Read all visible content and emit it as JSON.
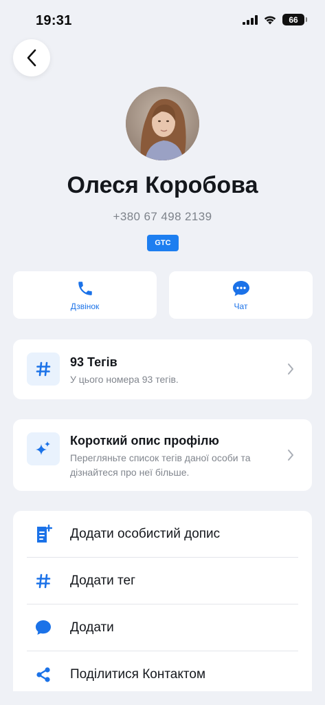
{
  "status_bar": {
    "time": "19:31",
    "battery": "66"
  },
  "profile": {
    "name": "Олеся Коробова",
    "phone": "+380 67 498 2139",
    "operator_badge": "GTC"
  },
  "actions": {
    "call_label": "Дзвінок",
    "chat_label": "Чат"
  },
  "tags_card": {
    "title": "93 Тегів",
    "subtitle": "У цього номера 93 тегів."
  },
  "summary_card": {
    "title": "Короткий опис профілю",
    "subtitle_line1": "Перегляньте список тегів даної особи та",
    "subtitle_line2": "дізнайтеся про неї більше."
  },
  "menu": {
    "items": [
      {
        "label": "Додати особистий допис",
        "icon": "note-add-icon"
      },
      {
        "label": "Додати тег",
        "icon": "hash-icon"
      },
      {
        "label": "Додати",
        "icon": "chat-bubble-icon"
      },
      {
        "label": "Поділитися Контактом",
        "icon": "share-icon"
      }
    ]
  },
  "colors": {
    "accent": "#1b72e8",
    "background": "#eff1f6",
    "card": "#ffffff",
    "badge": "#1d7ef0"
  }
}
